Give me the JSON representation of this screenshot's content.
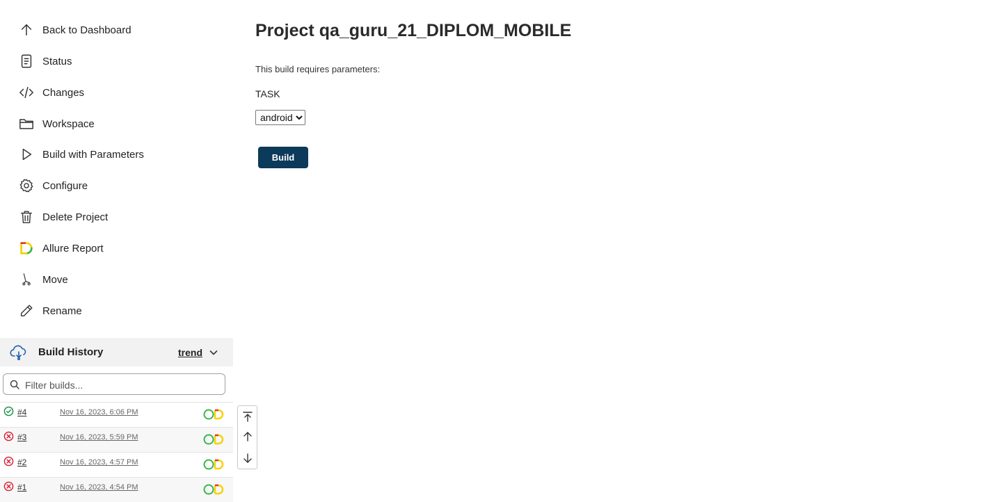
{
  "sidebar": {
    "tasks": [
      {
        "label": "Back to Dashboard",
        "icon": "arrow-up-icon"
      },
      {
        "label": "Status",
        "icon": "document-icon"
      },
      {
        "label": "Changes",
        "icon": "code-icon"
      },
      {
        "label": "Workspace",
        "icon": "folder-icon"
      },
      {
        "label": "Build with Parameters",
        "icon": "play-icon"
      },
      {
        "label": "Configure",
        "icon": "gear-icon"
      },
      {
        "label": "Delete Project",
        "icon": "trash-icon"
      },
      {
        "label": "Allure Report",
        "icon": "allure-icon"
      },
      {
        "label": "Move",
        "icon": "move-icon"
      },
      {
        "label": "Rename",
        "icon": "pencil-icon"
      }
    ]
  },
  "build_history": {
    "title": "Build History",
    "trend": "trend",
    "filter_placeholder": "Filter builds...",
    "builds": [
      {
        "number": "#4",
        "date": "Nov 16, 2023, 6:06 PM",
        "status": "success"
      },
      {
        "number": "#3",
        "date": "Nov 16, 2023, 5:59 PM",
        "status": "failed"
      },
      {
        "number": "#2",
        "date": "Nov 16, 2023, 4:57 PM",
        "status": "failed"
      },
      {
        "number": "#1",
        "date": "Nov 16, 2023, 4:54 PM",
        "status": "failed"
      }
    ]
  },
  "main": {
    "title": "Project qa_guru_21_DIPLOM_MOBILE",
    "requires_params": "This build requires parameters:",
    "param_name": "TASK",
    "param_value": "android",
    "build_button": "Build"
  },
  "colors": {
    "build_button": "#0b3a5b",
    "success": "#138d3c",
    "failure": "#d81a2e",
    "history_header": "#f2f2f3",
    "allure_yellow": "#f5d20a",
    "allure_red": "#e13a2e",
    "allure_green": "#3bb54a"
  }
}
